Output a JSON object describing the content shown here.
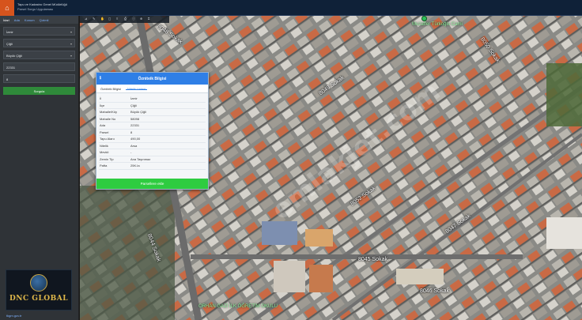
{
  "app": {
    "title": "Tapu ve Kadastro Genel Müdürlüğü",
    "subtitle": "Parsel Sorgu Uygulaması",
    "logo_icon": "home-icon",
    "accent": "#d6541d"
  },
  "sidebar": {
    "tabs": [
      {
        "label": "İdari"
      },
      {
        "label": "Ada"
      },
      {
        "label": "Konum"
      },
      {
        "label": "Çizimli"
      }
    ],
    "fields": [
      {
        "value": "İzmir"
      },
      {
        "value": "Çiğli"
      },
      {
        "value": "Büyük Çiğli"
      },
      {
        "value": "22331"
      },
      {
        "value": "8"
      }
    ],
    "search_label": "Sorgula",
    "search_color": "#2f8a3a",
    "brand_text": "DNC GLOBAL",
    "bottom_link": "tkgm.gov.tr"
  },
  "map": {
    "toolbar_icons": [
      "ruler-icon",
      "edit-icon",
      "hand-icon",
      "square-icon",
      "layers-icon",
      "print-icon",
      "info-icon",
      "zoom-icon",
      "measure-icon"
    ],
    "toolbar_glyphs": [
      "⊿",
      "✎",
      "✋",
      "◻",
      "≡",
      "⎙",
      "ⓘ",
      "⊕",
      "⌗"
    ],
    "streets": [
      {
        "name": "8052 Sokak"
      },
      {
        "name": "8049 Sokak"
      },
      {
        "name": "8045 Sokak"
      },
      {
        "name": "8046 Sokak"
      },
      {
        "name": "8048 Sokak"
      },
      {
        "name": "8047 Sokak"
      },
      {
        "name": "8044 Sokak"
      },
      {
        "name": "8050 Sokak"
      }
    ],
    "pois": [
      {
        "name": "Muzaffer Türkoğlu Cami",
        "color": "#8cf09a"
      },
      {
        "name": "ORHAN GAZİ İLK ÖĞRETİM OKULU",
        "color": "#8cf09a"
      }
    ],
    "watermark": "emlakjet.com"
  },
  "popup": {
    "title": "Özniteik Bilgisi",
    "header_icon": "info-icon",
    "tabs": [
      {
        "label": "Özniteik Bilgisi"
      },
      {
        "label": "Nitelik Listesi"
      }
    ],
    "rows": [
      {
        "key": "İl",
        "value": "İzmir"
      },
      {
        "key": "İlçe",
        "value": "Çiğli"
      },
      {
        "key": "Mahalle/Köy",
        "value": "Büyük Çiğli"
      },
      {
        "key": "Mahalle No",
        "value": "58098"
      },
      {
        "key": "Ada",
        "value": "22331"
      },
      {
        "key": "Parsel",
        "value": "8"
      },
      {
        "key": "Tapu Alanı",
        "value": "490,00"
      },
      {
        "key": "Nitelik",
        "value": "Arsa"
      },
      {
        "key": "Mevkii",
        "value": "-"
      },
      {
        "key": "Zemin Tip",
        "value": "Ana Taşınmaz"
      },
      {
        "key": "Pafta",
        "value": "25K.Ia"
      }
    ],
    "button_label": "Parsellere ekle",
    "header_color": "#2f7fe6",
    "button_color": "#2ecc40"
  }
}
